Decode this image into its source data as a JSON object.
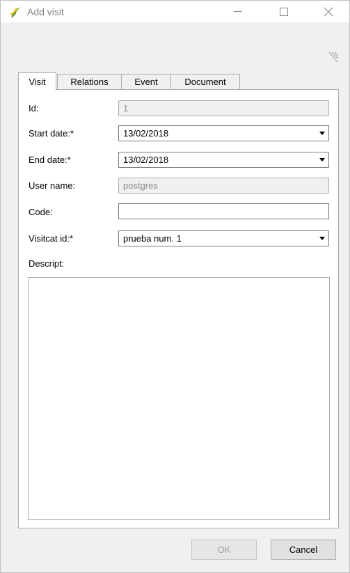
{
  "window": {
    "title": "Add visit",
    "controls": {
      "minimize": "—",
      "maximize": "□",
      "close": "✕"
    }
  },
  "tabs": [
    {
      "label": "Visit",
      "active": true
    },
    {
      "label": "Relations",
      "active": false
    },
    {
      "label": "Event",
      "active": false
    },
    {
      "label": "Document",
      "active": false
    }
  ],
  "form": {
    "id": {
      "label": "Id:",
      "value": "1"
    },
    "start_date": {
      "label": "Start date:*",
      "value": "13/02/2018"
    },
    "end_date": {
      "label": "End date:*",
      "value": "13/02/2018"
    },
    "user_name": {
      "label": "User name:",
      "value": "postgres"
    },
    "code": {
      "label": "Code:",
      "value": ""
    },
    "visitcat_id": {
      "label": "Visitcat id:*",
      "value": "prueba num. 1"
    },
    "descript": {
      "label": "Descript:",
      "value": ""
    }
  },
  "buttons": {
    "ok": "OK",
    "cancel": "Cancel"
  },
  "colors": {
    "accent_icon": "#8cc63f",
    "background": "#f0f0f0"
  }
}
